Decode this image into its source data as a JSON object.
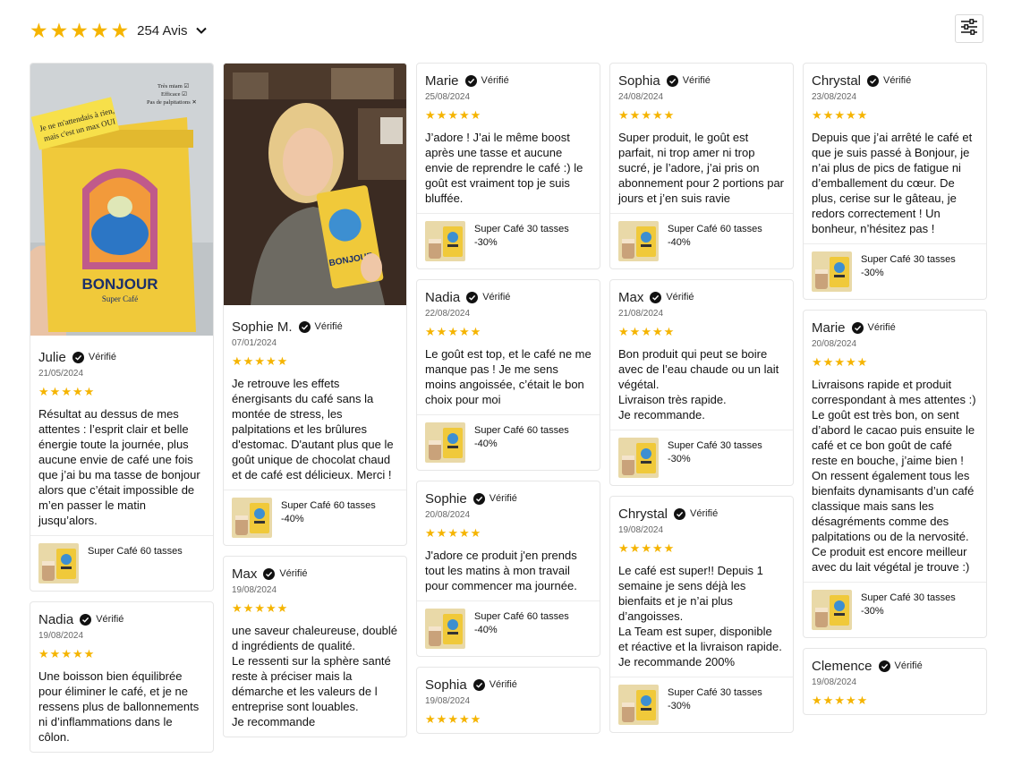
{
  "header": {
    "review_count": "254 Avis",
    "rating_stars": 5
  },
  "colors": {
    "star": "#f5b400",
    "product_yellow": "#f0c93a"
  },
  "icons": {
    "dropdown": "chevron-down-icon",
    "filter": "sliders-icon",
    "verified": "check-circle-icon",
    "star": "star-icon"
  },
  "photo_text": {
    "note_line1": "Je ne m'attendais à rien,",
    "note_line2": "mais c'est un max OUI",
    "check1": "Très miam ☑",
    "check2": "Efficace ☑",
    "check3": "Pas de palpitations ✕",
    "brand": "BONJOUR",
    "sub": "Super Café"
  },
  "columns": [
    [
      {
        "name": "Julie",
        "verified": "Vérifié",
        "date": "21/05/2024",
        "text": "Résultat au dessus de mes attentes : l’esprit clair et belle énergie toute la journée, plus aucune envie de café une fois que j’ai bu ma tasse de bonjour alors que c’était impossible de m’en passer le matin jusqu’alors.",
        "product_name": "Super Café 60 tasses",
        "product_discount": "",
        "photo": "pack"
      },
      {
        "name": "Nadia",
        "verified": "Vérifié",
        "date": "19/08/2024",
        "text": "Une boisson bien équilibrée pour éliminer le café, et je ne ressens plus de ballonnements ni d’inflammations dans le côlon.",
        "product_name": "",
        "product_discount": ""
      }
    ],
    [
      {
        "name": "Sophie M.",
        "verified": "Vérifié",
        "date": "07/01/2024",
        "text": "Je retrouve les effets énergisants du café sans la montée de stress, les palpitations et les brûlures d'estomac. D'autant plus que le goût unique de chocolat chaud et de café est délicieux. Merci !",
        "product_name": "Super Café 60 tasses",
        "product_discount": "-40%",
        "photo": "person"
      },
      {
        "name": "Max",
        "verified": "Vérifié",
        "date": "19/08/2024",
        "text": "une saveur chaleureuse, doublé d ingrédients de qualité.\nLe ressenti sur la sphère santé reste à préciser mais la démarche et les valeurs de l entreprise sont louables.\nJe recommande",
        "product_name": "",
        "product_discount": ""
      }
    ],
    [
      {
        "name": "Marie",
        "verified": "Vérifié",
        "date": "25/08/2024",
        "text": "J’adore ! J’ai le même boost après une tasse et aucune envie de reprendre le café :) le goût est vraiment top je suis bluffée.",
        "product_name": "Super Café 30 tasses",
        "product_discount": "-30%"
      },
      {
        "name": "Nadia",
        "verified": "Vérifié",
        "date": "22/08/2024",
        "text": "Le goût est top, et le café ne me manque pas ! Je me sens moins angoissée, c’était le bon choix pour moi",
        "product_name": "Super Café 60 tasses",
        "product_discount": "-40%"
      },
      {
        "name": "Sophie",
        "verified": "Vérifié",
        "date": "20/08/2024",
        "text": "J'adore ce produit j'en prends tout les matins à mon travail pour commencer ma journée.",
        "product_name": "Super Café 60 tasses",
        "product_discount": "-40%"
      },
      {
        "name": "Sophia",
        "verified": "Vérifié",
        "date": "19/08/2024",
        "text": "",
        "product_name": "",
        "product_discount": ""
      }
    ],
    [
      {
        "name": "Sophia",
        "verified": "Vérifié",
        "date": "24/08/2024",
        "text": "Super produit, le goût est parfait, ni trop amer ni trop sucré, je l’adore, j’ai pris on abonnement pour 2 portions par jours et j’en suis ravie",
        "product_name": "Super Café 60 tasses",
        "product_discount": "-40%"
      },
      {
        "name": "Max",
        "verified": "Vérifié",
        "date": "21/08/2024",
        "text": "Bon produit qui peut se boire avec de l’eau chaude ou un lait végétal.\nLivraison très rapide.\nJe recommande.",
        "product_name": "Super Café 30 tasses",
        "product_discount": "-30%"
      },
      {
        "name": "Chrystal",
        "verified": "Vérifié",
        "date": "19/08/2024",
        "text": "Le café est super!! Depuis 1 semaine je sens déjà les bienfaits et je n’ai plus d’angoisses.\nLa Team est super, disponible et réactive et la livraison rapide. Je recommande 200%",
        "product_name": "Super Café 30 tasses",
        "product_discount": "-30%"
      }
    ],
    [
      {
        "name": "Chrystal",
        "verified": "Vérifié",
        "date": "23/08/2024",
        "text": "Depuis que j’ai arrêté le café et que je suis passé à Bonjour, je n’ai plus de pics de fatigue ni d’emballement du cœur. De plus, cerise sur le gâteau, je redors correctement ! Un bonheur, n’hésitez pas !",
        "product_name": "Super Café 30 tasses",
        "product_discount": "-30%"
      },
      {
        "name": "Marie",
        "verified": "Vérifié",
        "date": "20/08/2024",
        "text": "Livraisons rapide et produit correspondant à mes attentes :) Le goût est très bon, on sent d’abord le cacao puis ensuite le café et ce bon goût de café reste en bouche, j’aime bien ! On ressent également tous les bienfaits dynamisants d’un café classique mais sans les désagréments comme des palpitations ou de la nervosité. Ce produit est encore meilleur avec du lait végétal je trouve :)",
        "product_name": "Super Café 30 tasses",
        "product_discount": "-30%"
      },
      {
        "name": "Clemence",
        "verified": "Vérifié",
        "date": "19/08/2024",
        "text": "",
        "product_name": "",
        "product_discount": ""
      }
    ]
  ]
}
